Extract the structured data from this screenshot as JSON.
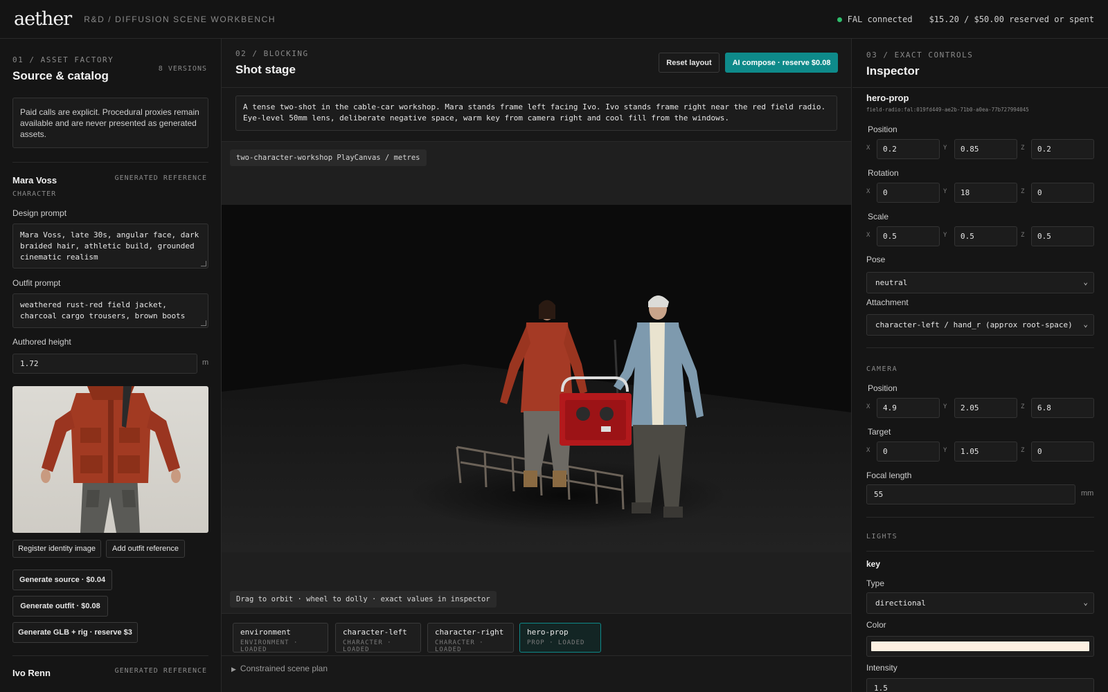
{
  "header": {
    "logo": "aether",
    "breadcrumb": "R&D / DIFFUSION SCENE WORKBENCH",
    "status": "FAL connected",
    "budget": "$15.20 / $50.00 reserved or spent"
  },
  "left": {
    "kicker": "01 / ASSET FACTORY",
    "title": "Source & catalog",
    "versions": "8 VERSIONS",
    "notice": "Paid calls are explicit. Procedural proxies remain available and are never presented as generated assets.",
    "character": {
      "name": "Mara Voss",
      "badge": "GENERATED REFERENCE",
      "type": "CHARACTER",
      "design_label": "Design prompt",
      "design_prompt": "Mara Voss, late 30s, angular face, dark braided hair, athletic build, grounded cinematic realism",
      "outfit_label": "Outfit prompt",
      "outfit_prompt": "weathered rust-red field jacket, charcoal cargo trousers, brown boots",
      "height_label": "Authored height",
      "height": "1.72",
      "height_unit": "m"
    },
    "buttons": {
      "register": "Register identity image",
      "add_outfit": "Add outfit reference",
      "gen_source": "Generate source · $0.04",
      "gen_outfit": "Generate outfit · $0.08",
      "gen_glb": "Generate GLB + rig · reserve $3"
    },
    "next_character": {
      "name": "Ivo Renn",
      "badge": "GENERATED REFERENCE"
    }
  },
  "center": {
    "kicker": "02 / BLOCKING",
    "title": "Shot stage",
    "reset": "Reset layout",
    "compose": "AI compose · reserve $0.08",
    "scene_prompt": "A tense two-shot in the cable-car workshop. Mara stands frame left facing Ivo. Ivo stands frame right near the red field radio. Eye-level 50mm lens, deliberate negative space, warm key from camera right and cool fill from the windows.",
    "scene_chip": "two-character-workshop  PlayCanvas / metres",
    "hint": "Drag to orbit · wheel to dolly · exact values in inspector",
    "assets": [
      {
        "name": "environment",
        "meta": "ENVIRONMENT · LOADED"
      },
      {
        "name": "character-left",
        "meta": "CHARACTER · LOADED"
      },
      {
        "name": "character-right",
        "meta": "CHARACTER · LOADED"
      },
      {
        "name": "hero-prop",
        "meta": "PROP · LOADED"
      }
    ],
    "plan": "Constrained scene plan"
  },
  "inspector": {
    "kicker": "03 / EXACT CONTROLS",
    "title": "Inspector",
    "object": "hero-prop",
    "object_id": "field-radio:fal:019fd449-ae2b-71b0-a0ea-77b727994045",
    "position_label": "Position",
    "position": {
      "x": "0.2",
      "y": "0.85",
      "z": "0.2"
    },
    "rotation_label": "Rotation",
    "rotation": {
      "x": "0",
      "y": "18",
      "z": "0"
    },
    "scale_label": "Scale",
    "scale": {
      "x": "0.5",
      "y": "0.5",
      "z": "0.5"
    },
    "pose_label": "Pose",
    "pose": "neutral",
    "attachment_label": "Attachment",
    "attachment": "character-left / hand_r (approx root-space)",
    "camera_section": "CAMERA",
    "cam_position_label": "Position",
    "cam_position": {
      "x": "4.9",
      "y": "2.05",
      "z": "6.8"
    },
    "target_label": "Target",
    "target": {
      "x": "0",
      "y": "1.05",
      "z": "0"
    },
    "focal_label": "Focal length",
    "focal": "55",
    "focal_unit": "mm",
    "lights_section": "LIGHTS",
    "light_name": "key",
    "type_label": "Type",
    "type": "directional",
    "color_label": "Color",
    "color": "#fdf0e2",
    "intensity_label": "Intensity",
    "intensity": "1.5",
    "axes": {
      "x": "X",
      "y": "Y",
      "z": "Z"
    }
  },
  "colors": {
    "accent": "#0e8a8a",
    "status_ok": "#2ebd6b",
    "radio_red": "#b3191c"
  }
}
